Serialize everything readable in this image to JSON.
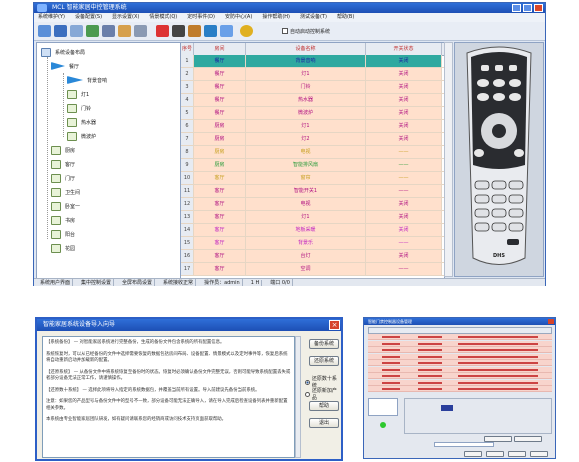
{
  "main": {
    "window_title": "MCL     智能家居中控管理系统",
    "menu": [
      "系统维护(Y)",
      "设备配置(S)",
      "显示设置(X)",
      "情景模式(Q)",
      "定时事件(D)",
      "安防中心(A)",
      "操作帮助(H)",
      "测试设备(T)",
      "帮助(B)"
    ],
    "option_label": "自动启动控制系统",
    "tree": {
      "root": "系统设备布局",
      "items": [
        {
          "label": "餐厅",
          "level": 1,
          "icon": "folder-open-icon"
        },
        {
          "label": "背景音响",
          "level": 2,
          "icon": "speaker-selected-icon"
        },
        {
          "label": "灯1",
          "level": 2,
          "icon": "device-icon"
        },
        {
          "label": "门铃",
          "level": 2,
          "icon": "device-icon"
        },
        {
          "label": "热水器",
          "level": 2,
          "icon": "device-icon"
        },
        {
          "label": "微波炉",
          "level": 2,
          "icon": "device-icon"
        },
        {
          "label": "厨房",
          "level": 1,
          "icon": "device-icon"
        },
        {
          "label": "客厅",
          "level": 1,
          "icon": "device-icon"
        },
        {
          "label": "门厅",
          "level": 1,
          "icon": "device-icon"
        },
        {
          "label": "卫生间",
          "level": 1,
          "icon": "device-icon"
        },
        {
          "label": "卧室一",
          "level": 1,
          "icon": "device-icon"
        },
        {
          "label": "书房",
          "level": 1,
          "icon": "device-icon"
        },
        {
          "label": "阳台",
          "level": 1,
          "icon": "device-icon"
        },
        {
          "label": "花园",
          "level": 1,
          "icon": "device-icon"
        }
      ]
    },
    "grid": {
      "columns": [
        "序号",
        "房间",
        "设备名称",
        "开关状态"
      ],
      "rows": [
        {
          "no": "1",
          "room": "餐厅",
          "device": "背景音响",
          "state": "关闭",
          "color": "#2fa9a0",
          "text": "#b01080"
        },
        {
          "no": "2",
          "room": "餐厅",
          "device": "灯1",
          "state": "关闭",
          "color": "#ffe0cc",
          "text": "#b01080"
        },
        {
          "no": "3",
          "room": "餐厅",
          "device": "门铃",
          "state": "关闭",
          "color": "#ffe0cc",
          "text": "#b01080"
        },
        {
          "no": "4",
          "room": "餐厅",
          "device": "热水器",
          "state": "关闭",
          "color": "#ffe0cc",
          "text": "#b01080"
        },
        {
          "no": "5",
          "room": "餐厅",
          "device": "微波炉",
          "state": "关闭",
          "color": "#ffe0cc",
          "text": "#b01080"
        },
        {
          "no": "6",
          "room": "厨房",
          "device": "灯1",
          "state": "关闭",
          "color": "#ffe0cc",
          "text": "#b01080"
        },
        {
          "no": "7",
          "room": "厨房",
          "device": "灯2",
          "state": "关闭",
          "color": "#ffe0cc",
          "text": "#b01080"
        },
        {
          "no": "8",
          "room": "厨房",
          "device": "电视",
          "state": "——",
          "color": "#ffe0cc",
          "text": "#c8a020"
        },
        {
          "no": "9",
          "room": "厨房",
          "device": "智能排风扇",
          "state": "——",
          "color": "#ffe0cc",
          "text": "#2c9c3c"
        },
        {
          "no": "10",
          "room": "客厅",
          "device": "窗帘",
          "state": "——",
          "color": "#ffe0cc",
          "text": "#c8a020"
        },
        {
          "no": "11",
          "room": "客厅",
          "device": "智能开关1",
          "state": "——",
          "color": "#ffe0cc",
          "text": "#b01080"
        },
        {
          "no": "12",
          "room": "客厅",
          "device": "电视",
          "state": "关闭",
          "color": "#ffe0cc",
          "text": "#b01080"
        },
        {
          "no": "13",
          "room": "客厅",
          "device": "灯1",
          "state": "关闭",
          "color": "#ffe0cc",
          "text": "#b01080"
        },
        {
          "no": "14",
          "room": "客厅",
          "device": "地板采暖",
          "state": "关闭",
          "color": "#ffe0cc",
          "text": "#c020c0"
        },
        {
          "no": "15",
          "room": "客厅",
          "device": "背景乐",
          "state": "——",
          "color": "#ffe0cc",
          "text": "#c020c0"
        },
        {
          "no": "16",
          "room": "客厅",
          "device": "台灯",
          "state": "关闭",
          "color": "#ffe0cc",
          "text": "#b01080"
        },
        {
          "no": "17",
          "room": "客厅",
          "device": "空调",
          "state": "——",
          "color": "#ffe0cc",
          "text": "#b01080"
        }
      ]
    },
    "remote_brand": "DHS",
    "status": [
      "系统用户界面",
      "集中控制设置",
      "全屏布局设置",
      "系统接收正常",
      "操作员：admin",
      "1 H",
      "端口 0/0"
    ]
  },
  "dialog": {
    "title": "智能家居系统设备导入向导",
    "close": "×",
    "paragraphs": [
      "【系统备份】 — 对智能家居系统进行完整备份，生成的备份文件包含系统的所有配置信息。",
      "系统恢复时，可以从已经备份的文件中选择需要恢复的数据包括房间布局、设备配置、情景模式以及定时事件等，恢复后系统将自动重新启动并加载新的配置。",
      "【还原系统】 — 从备份文件中将系统恢复至备份时的状态。恢复时必须确认备份文件完整无误，否则可能导致系统配置丢失或者部分设备无法正常工作，请谨慎操作。",
      "【还原数十系统】 — 选择此项将导入指定的系统数据包，并覆盖当前所有设置。导入前建议先备份当前系统。",
      "注意：如果您的产品型号与备份文件中的型号不一致，部分设备可能无法正确导入，请在导入完成后检查设备列表并重新配置相关参数。",
      "本系统由专业智能家居团队研发，如有疑问请联系您的经销商或访问技术支持页面获取帮助。"
    ],
    "buttons": {
      "backup": "备份系统",
      "restore": "还原系统",
      "help": "帮助",
      "exit": "退出"
    },
    "radios": [
      {
        "label": "还原数十系统",
        "checked": true
      },
      {
        "label": "还原新加产品",
        "checked": false
      }
    ]
  },
  "small_window": {
    "title": "智能门禁控制器设备管理"
  }
}
